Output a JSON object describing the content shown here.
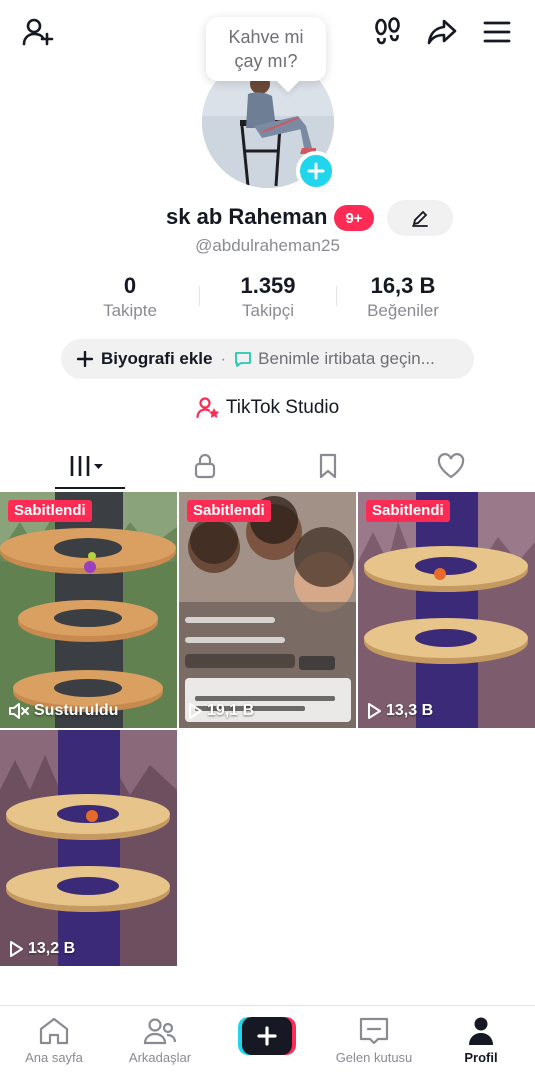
{
  "bubble": {
    "line1": "Kahve mi",
    "line2": "çay mı?"
  },
  "profile": {
    "name": "sk ab Raheman",
    "notification_badge": "9+",
    "handle": "@abdulraheman25"
  },
  "stats": [
    {
      "value": "0",
      "label": "Takipte"
    },
    {
      "value": "1.359",
      "label": "Takipçi"
    },
    {
      "value": "16,3 B",
      "label": "Beğeniler"
    }
  ],
  "bio": {
    "add_label": "Biyografi ekle",
    "separator": "·",
    "contact_label": "Benimle irtibata geçin..."
  },
  "studio": {
    "label": "TikTok Studio"
  },
  "tabs": [
    "videos-grid-icon",
    "lock-icon",
    "bookmark-icon",
    "heart-icon"
  ],
  "videos": [
    {
      "pinned_label": "Sabitlendi",
      "status": "Susturuldu",
      "muted": true
    },
    {
      "pinned_label": "Sabitlendi",
      "status": "19,1 B",
      "muted": false
    },
    {
      "pinned_label": "Sabitlendi",
      "status": "13,3 B",
      "muted": false
    },
    {
      "pinned_label": "",
      "status": "13,2 B",
      "muted": false
    }
  ],
  "bottom_nav": [
    {
      "label": "Ana sayfa",
      "icon": "home-icon"
    },
    {
      "label": "Arkadaşlar",
      "icon": "friends-icon"
    },
    {
      "label": "",
      "icon": "create-icon"
    },
    {
      "label": "Gelen kutusu",
      "icon": "inbox-icon"
    },
    {
      "label": "Profil",
      "icon": "profile-icon"
    }
  ],
  "colors": {
    "accent": "#fe2c55",
    "cyan": "#20d5ec",
    "text": "#161823",
    "muted": "#8a8b91"
  }
}
